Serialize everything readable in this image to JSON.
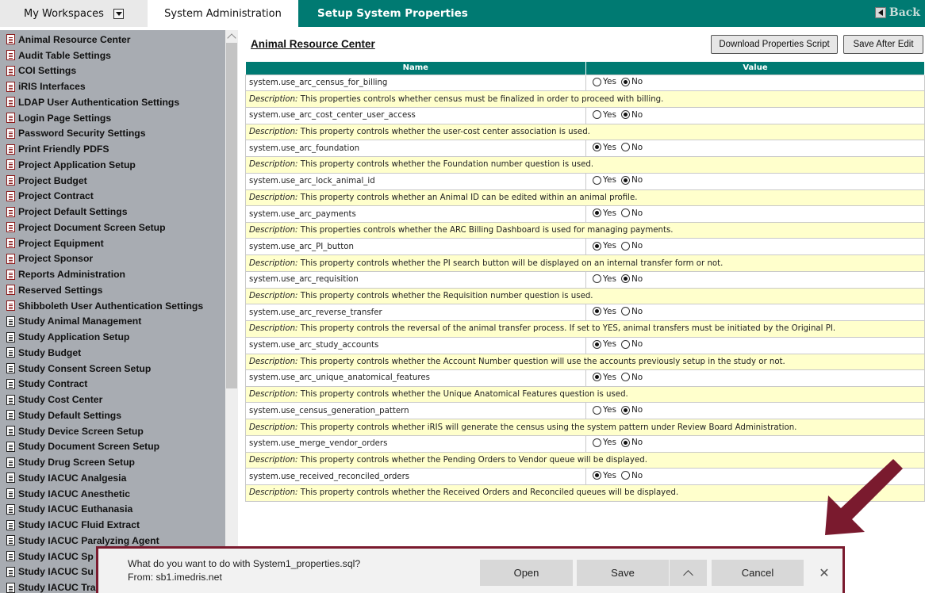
{
  "header": {
    "workspaces_label": "My Workspaces",
    "active_tab": "System Administration",
    "page_title": "Setup System Properties",
    "back_label": "Back"
  },
  "sidebar": {
    "items": [
      {
        "label": "Animal Resource Center",
        "icon": "doc-icon"
      },
      {
        "label": "Audit Table Settings",
        "icon": "doc-icon"
      },
      {
        "label": "COI Settings",
        "icon": "doc-icon"
      },
      {
        "label": "iRIS Interfaces",
        "icon": "doc-icon"
      },
      {
        "label": "LDAP User Authentication Settings",
        "icon": "doc-icon"
      },
      {
        "label": "Login Page Settings",
        "icon": "doc-icon"
      },
      {
        "label": "Password Security Settings",
        "icon": "doc-icon"
      },
      {
        "label": "Print Friendly PDFS",
        "icon": "doc-icon"
      },
      {
        "label": "Project Application Setup",
        "icon": "doc-icon"
      },
      {
        "label": "Project Budget",
        "icon": "doc-icon"
      },
      {
        "label": "Project Contract",
        "icon": "doc-icon"
      },
      {
        "label": "Project Default Settings",
        "icon": "doc-icon"
      },
      {
        "label": "Project Document Screen Setup",
        "icon": "doc-icon"
      },
      {
        "label": "Project Equipment",
        "icon": "doc-icon"
      },
      {
        "label": "Project Sponsor",
        "icon": "doc-icon"
      },
      {
        "label": "Reports Administration",
        "icon": "doc-icon"
      },
      {
        "label": "Reserved Settings",
        "icon": "doc-icon"
      },
      {
        "label": "Shibboleth User Authentication Settings",
        "icon": "doc-icon"
      },
      {
        "label": "Study Animal Management",
        "icon": "doc-icon-alt"
      },
      {
        "label": "Study Application Setup",
        "icon": "doc-icon-alt"
      },
      {
        "label": "Study Budget",
        "icon": "doc-icon-alt"
      },
      {
        "label": "Study Consent Screen Setup",
        "icon": "doc-icon-alt"
      },
      {
        "label": "Study Contract",
        "icon": "doc-icon-alt"
      },
      {
        "label": "Study Cost Center",
        "icon": "doc-icon-alt"
      },
      {
        "label": "Study Default Settings",
        "icon": "doc-icon-alt"
      },
      {
        "label": "Study Device Screen Setup",
        "icon": "doc-icon-alt"
      },
      {
        "label": "Study Document Screen Setup",
        "icon": "doc-icon-alt"
      },
      {
        "label": "Study Drug Screen Setup",
        "icon": "doc-icon-alt"
      },
      {
        "label": "Study IACUC Analgesia",
        "icon": "doc-icon-alt"
      },
      {
        "label": "Study IACUC Anesthetic",
        "icon": "doc-icon-alt"
      },
      {
        "label": "Study IACUC Euthanasia",
        "icon": "doc-icon-alt"
      },
      {
        "label": "Study IACUC Fluid Extract",
        "icon": "doc-icon-alt"
      },
      {
        "label": "Study IACUC Paralyzing Agent",
        "icon": "doc-icon-alt"
      },
      {
        "label": "Study IACUC Sp",
        "icon": "doc-icon-alt"
      },
      {
        "label": "Study IACUC Su",
        "icon": "doc-icon-alt"
      },
      {
        "label": "Study IACUC Tra",
        "icon": "doc-icon-alt"
      }
    ]
  },
  "main": {
    "section_title": "Animal Resource Center",
    "download_button": "Download Properties Script",
    "save_button": "Save After Edit",
    "columns": {
      "name": "Name",
      "value": "Value"
    },
    "yes_label": "Yes",
    "no_label": "No",
    "description_prefix": "Description:",
    "properties": [
      {
        "name": "system.use_arc_census_for_billing",
        "value": "No",
        "description": "This properties controls whether census must be finalized in order to proceed with billing."
      },
      {
        "name": "system.use_arc_cost_center_user_access",
        "value": "No",
        "description": "This property controls whether the user-cost center association is used."
      },
      {
        "name": "system.use_arc_foundation",
        "value": "Yes",
        "description": "This property controls whether the Foundation number question is used."
      },
      {
        "name": "system.use_arc_lock_animal_id",
        "value": "No",
        "description": "This property controls whether an Animal ID can be edited within an animal profile."
      },
      {
        "name": "system.use_arc_payments",
        "value": "Yes",
        "description": "This properties controls whether the ARC Billing Dashboard is used for managing payments."
      },
      {
        "name": "system.use_arc_PI_button",
        "value": "Yes",
        "description": "This property controls whether the PI search button will be displayed on an internal transfer form or not."
      },
      {
        "name": "system.use_arc_requisition",
        "value": "No",
        "description": "This property controls whether the Requisition number question is used."
      },
      {
        "name": "system.use_arc_reverse_transfer",
        "value": "Yes",
        "description": "This property controls the reversal of the animal transfer process. If set to YES, animal transfers must be initiated by the Original PI."
      },
      {
        "name": "system.use_arc_study_accounts",
        "value": "Yes",
        "description": "This property controls whether the Account Number question will use the accounts previously setup in the study or not."
      },
      {
        "name": "system.use_arc_unique_anatomical_features",
        "value": "Yes",
        "description": "This property controls whether the Unique Anatomical Features question is used."
      },
      {
        "name": "system.use_census_generation_pattern",
        "value": "No",
        "description": "This property controls whether iRIS will generate the census using the system pattern under Review Board Administration."
      },
      {
        "name": "system.use_merge_vendor_orders",
        "value": "No",
        "description": "This property controls whether the Pending Orders to Vendor queue will be displayed."
      },
      {
        "name": "system.use_received_reconciled_orders",
        "value": "Yes",
        "description": "This property controls whether the Received Orders and Reconciled queues will be displayed."
      }
    ]
  },
  "download_dialog": {
    "question": "What do you want to do with System1_properties.sql?",
    "source": "From: sb1.imedris.net",
    "open_label": "Open",
    "save_label": "Save",
    "more_icon": "chevron-up-icon",
    "cancel_label": "Cancel",
    "close_glyph": "✕"
  },
  "colors": {
    "header_teal": "#007a72",
    "sidebar_gray": "#a8acb2",
    "description_yellow": "#ffffcc",
    "annotation_red": "#7a1a2e"
  }
}
